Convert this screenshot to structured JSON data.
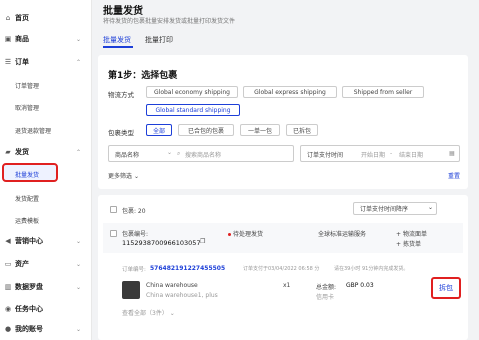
{
  "sidebar": {
    "items": [
      {
        "label": "首页",
        "icon": "home-icon"
      },
      {
        "label": "商品",
        "icon": "box-icon"
      },
      {
        "label": "订单",
        "icon": "list-icon"
      },
      {
        "label": "发货",
        "icon": "truck-icon"
      },
      {
        "label": "营销中心",
        "icon": "megaphone-icon"
      },
      {
        "label": "资产",
        "icon": "wallet-icon"
      },
      {
        "label": "数据罗盘",
        "icon": "chart-icon"
      },
      {
        "label": "任务中心",
        "icon": "task-icon"
      },
      {
        "label": "我的账号",
        "icon": "user-icon"
      }
    ],
    "order_sub": [
      "订单管理",
      "取消管理",
      "退货退款管理"
    ],
    "ship_sub": [
      "批量发货",
      "发货配置",
      "运费模板"
    ]
  },
  "header": {
    "title": "批量发货",
    "subtitle": "将待发货的包裹批量安排发货或批量打印发货文件"
  },
  "tabs": [
    "批量发货",
    "批量打印"
  ],
  "step": {
    "title": "第1步：选择包裹",
    "logistics_label": "物流方式",
    "logistics_options": [
      "Global economy shipping",
      "Global express shipping",
      "Shipped from seller",
      "Global standard shipping"
    ],
    "pkg_label": "包裹类型",
    "pkg_options": [
      "全部",
      "已合包的包裹",
      "一单一包",
      "已拆包"
    ],
    "search_select": "商品名称",
    "search_placeholder": "搜索商品名称",
    "date_label": "订单支付时间",
    "date_start": "开始日期",
    "date_sep": "-",
    "date_end": "结束日期",
    "more_filters": "更多筛选",
    "reset": "重置"
  },
  "list": {
    "count_label": "包裹: 20",
    "sort_label": "订单支付时间降序",
    "pkg_id_label": "包裹编号:",
    "pkg_id": "1152938700966103057",
    "status": "待处理发货",
    "service": "全球标准运输服务",
    "actions": [
      "物流面单",
      "拣货单"
    ],
    "order_label": "订单编号:",
    "order_id": "576482191227455505",
    "order_meta": "订单支付于03/04/2022 06:58 分",
    "order_note": "请在39小时 91分钟内完成发货。",
    "product_name": "China warehouse",
    "product_sub": "China warehouse1, plus",
    "qty": "x1",
    "total_label": "总金额:",
    "total_value": "GBP 0.03",
    "total_sub": "信用卡",
    "view_all": "查看全部（3件）",
    "split_button": "拆包"
  }
}
